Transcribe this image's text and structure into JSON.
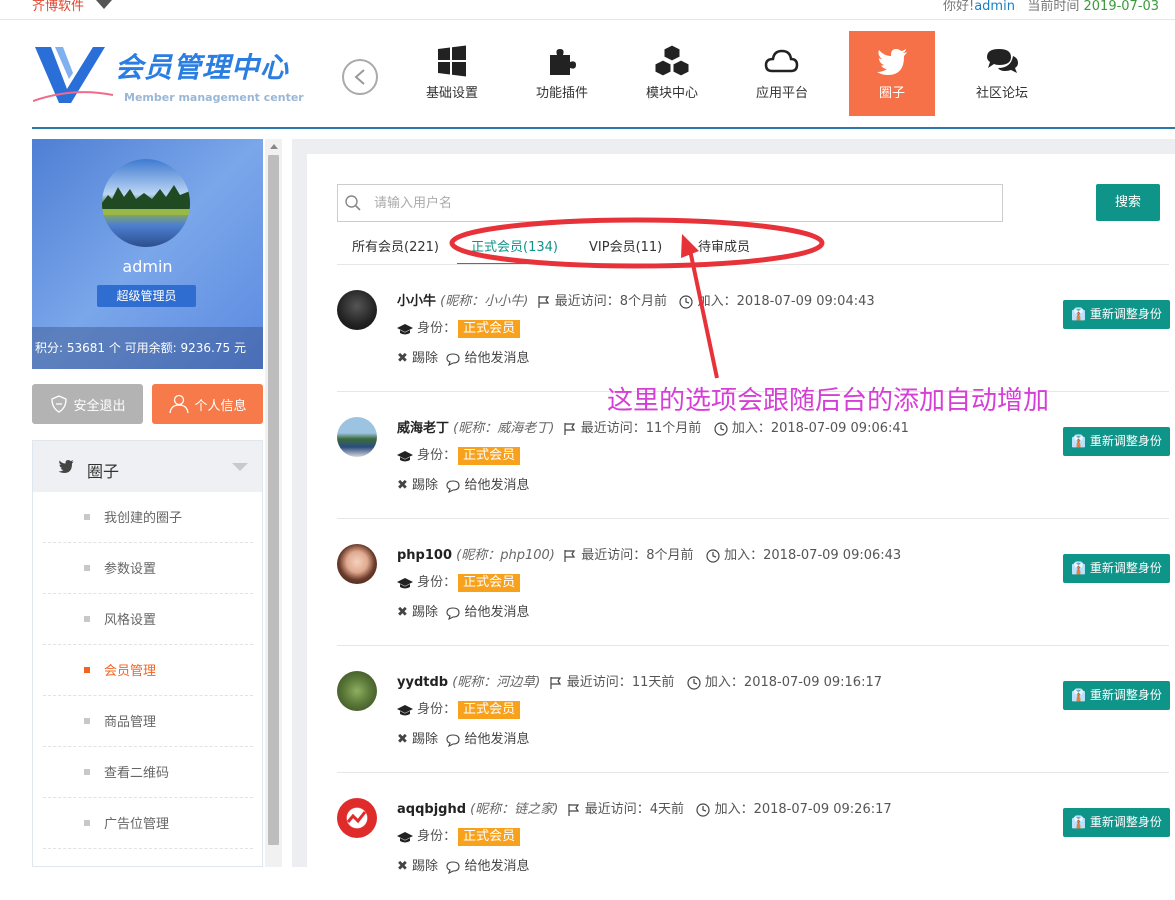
{
  "topbar": {
    "brand": "齐博软件",
    "greeting_prefix": "你好!",
    "username": "admin",
    "time_prefix": "当前时间",
    "time_value": "2019-07-03"
  },
  "logo": {
    "title": "会员管理中心",
    "subtitle": "Member management center"
  },
  "nav": [
    {
      "label": "基础设置",
      "icon": "windows-icon"
    },
    {
      "label": "功能插件",
      "icon": "puzzle-icon"
    },
    {
      "label": "模块中心",
      "icon": "cubes-icon"
    },
    {
      "label": "应用平台",
      "icon": "cloud-icon"
    },
    {
      "label": "圈子",
      "icon": "twitter-icon",
      "active": true
    },
    {
      "label": "社区论坛",
      "icon": "comments-icon"
    }
  ],
  "profile": {
    "name": "admin",
    "role": "超级管理员",
    "stats": "积分:  53681  个   可用余额:  9236.75  元"
  },
  "buttons": {
    "logout": "安全退出",
    "profile": "个人信息",
    "search": "搜索"
  },
  "menu": {
    "title": "圈子",
    "items": [
      {
        "label": "我创建的圈子"
      },
      {
        "label": "参数设置"
      },
      {
        "label": "风格设置"
      },
      {
        "label": "会员管理",
        "active": true
      },
      {
        "label": "商品管理"
      },
      {
        "label": "查看二维码"
      },
      {
        "label": "广告位管理"
      }
    ]
  },
  "search": {
    "placeholder": "请输入用户名"
  },
  "tabs": [
    {
      "label": "所有会员(221)"
    },
    {
      "label": "正式会员(134)",
      "active": true
    },
    {
      "label": "VIP会员(11)"
    },
    {
      "label": "待审成员"
    }
  ],
  "member_labels": {
    "last_visit": "最近访问：",
    "joined": "加入：",
    "identity": "身份：",
    "kick": "踢除",
    "message": "给他发消息",
    "adjust": "重新调整身份"
  },
  "members": [
    {
      "name": "小小牛",
      "nick": "(昵称：小小牛)",
      "last_visit": "8个月前",
      "joined": "2018-07-09 09:04:43",
      "role": "正式会员"
    },
    {
      "name": "威海老丁",
      "nick": "(昵称：威海老丁)",
      "last_visit": "11个月前",
      "joined": "2018-07-09 09:06:41",
      "role": "正式会员"
    },
    {
      "name": "php100",
      "nick": "(昵称：php100)",
      "last_visit": "8个月前",
      "joined": "2018-07-09 09:06:43",
      "role": "正式会员"
    },
    {
      "name": "yydtdb",
      "nick": "(昵称：河边草)",
      "last_visit": "11天前",
      "joined": "2018-07-09 09:16:17",
      "role": "正式会员"
    },
    {
      "name": "aqqbjghd",
      "nick": "(昵称：链之家)",
      "last_visit": "4天前",
      "joined": "2018-07-09 09:26:17",
      "role": "正式会员"
    }
  ],
  "annotation": {
    "text": "这里的选项会跟随后台的添加自动增加",
    "color": "#d63fd6",
    "ellipse_color": "#e8323a"
  },
  "colors": {
    "accent": "#0f9489",
    "active_nav": "#f67148",
    "role_badge": "#f8a11d"
  }
}
